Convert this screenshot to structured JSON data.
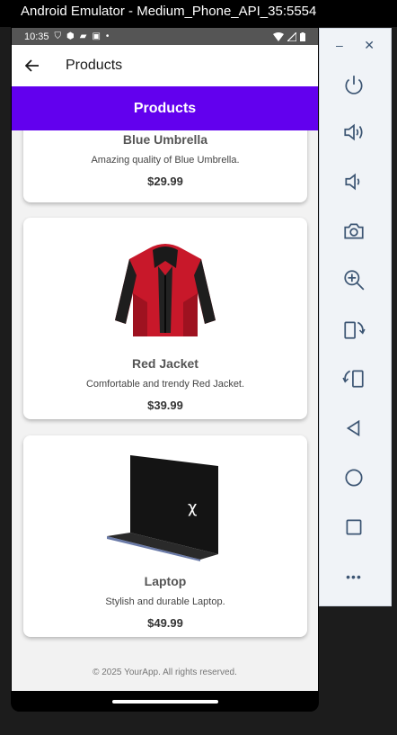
{
  "emulator": {
    "title": "Android Emulator - Medium_Phone_API_35:5554"
  },
  "statusbar": {
    "time": "10:35"
  },
  "appbar": {
    "title": "Products"
  },
  "banner": {
    "title": "Products"
  },
  "products": [
    {
      "name": "Blue Umbrella",
      "description": "Amazing quality of Blue Umbrella.",
      "price": "$29.99"
    },
    {
      "name": "Red Jacket",
      "description": "Comfortable and trendy Red Jacket.",
      "price": "$39.99"
    },
    {
      "name": "Laptop",
      "description": "Stylish and durable Laptop.",
      "price": "$49.99"
    }
  ],
  "footer": {
    "text": "© 2025 YourApp. All rights reserved."
  },
  "toolbar": {
    "minimize": "–",
    "close": "✕",
    "more": "•••",
    "icons": [
      "power-icon",
      "volume-up-icon",
      "volume-down-icon",
      "camera-icon",
      "zoom-in-icon",
      "rotate-left-icon",
      "rotate-right-icon",
      "back-icon",
      "home-icon",
      "overview-icon",
      "more-icon"
    ]
  },
  "colors": {
    "accent": "#6200ee",
    "screen_bg": "#f2f2f2",
    "toolbar_icon": "#3c5573"
  }
}
